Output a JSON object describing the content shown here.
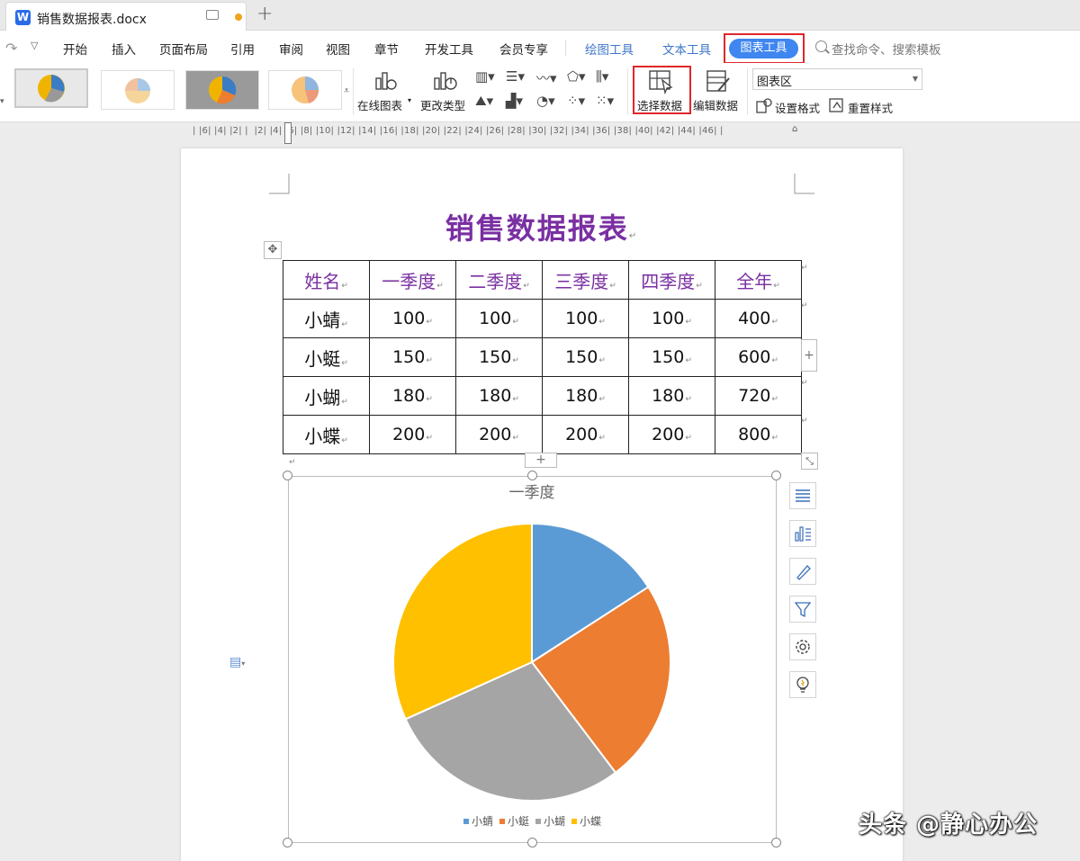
{
  "window": {
    "doc_tab_title": "销售数据报表.docx"
  },
  "menu": {
    "items": [
      "开始",
      "插入",
      "页面布局",
      "引用",
      "审阅",
      "视图",
      "章节",
      "开发工具",
      "会员专享"
    ],
    "context_tabs": [
      "绘图工具",
      "文本工具"
    ],
    "active_tab": "图表工具",
    "search_placeholder": "查找命令、搜索模板"
  },
  "ribbon": {
    "online_chart": "在线图表",
    "change_type": "更改类型",
    "select_data": "选择数据",
    "edit_data": "编辑数据",
    "chart_area_value": "图表区",
    "set_format": "设置格式",
    "reset_style": "重置样式"
  },
  "ruler": {
    "text": "| |6| |4| |2| |  |2| |4| |6| |8| |10| |12| |14| |16| |18| |20| |22| |24| |26| |28| |30| |32| |34| |36| |38| |40| |42| |44| |46| |"
  },
  "document": {
    "title": "销售数据报表",
    "table": {
      "headers": [
        "姓名",
        "一季度",
        "二季度",
        "三季度",
        "四季度",
        "全年"
      ],
      "rows": [
        [
          "小蜻",
          "100",
          "100",
          "100",
          "100",
          "400"
        ],
        [
          "小蜓",
          "150",
          "150",
          "150",
          "150",
          "600"
        ],
        [
          "小蝴",
          "180",
          "180",
          "180",
          "180",
          "720"
        ],
        [
          "小蝶",
          "200",
          "200",
          "200",
          "200",
          "800"
        ]
      ]
    }
  },
  "chart_data": {
    "type": "pie",
    "title": "一季度",
    "categories": [
      "小蜻",
      "小蜓",
      "小蝴",
      "小蝶"
    ],
    "values": [
      100,
      150,
      180,
      200
    ],
    "colors": [
      "#5b9bd5",
      "#ed7d31",
      "#a5a5a5",
      "#ffc000"
    ],
    "legend": "bottom"
  },
  "watermark": "头条 @静心办公"
}
